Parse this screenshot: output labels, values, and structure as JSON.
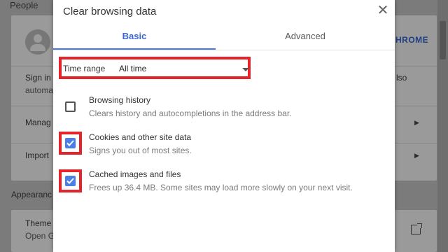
{
  "background": {
    "section_people": "People",
    "sign_in_text": "Sign in",
    "sign_in_sub": "automa",
    "right_text": "lso",
    "chrome_link": "HROME",
    "manage_label": "Manag",
    "import_label": "Import",
    "appearance_label": "Appearanc",
    "themes_label": "Theme",
    "themes_sub": "Open G"
  },
  "dialog": {
    "title": "Clear browsing data",
    "close_icon": "close-icon",
    "tabs": [
      {
        "label": "Basic",
        "active": true
      },
      {
        "label": "Advanced",
        "active": false
      }
    ],
    "time_range": {
      "label": "Time range",
      "value": "All time"
    },
    "options": [
      {
        "title": "Browsing history",
        "description": "Clears history and autocompletions in the address bar.",
        "checked": false,
        "highlighted": false
      },
      {
        "title": "Cookies and other site data",
        "description": "Signs you out of most sites.",
        "checked": true,
        "highlighted": true
      },
      {
        "title": "Cached images and files",
        "description": "Frees up 36.4 MB. Some sites may load more slowly on your next visit.",
        "checked": true,
        "highlighted": true
      }
    ]
  },
  "colors": {
    "accent": "#4a76e8",
    "highlight": "#e2242b",
    "checkbox": "#4a80e6"
  }
}
